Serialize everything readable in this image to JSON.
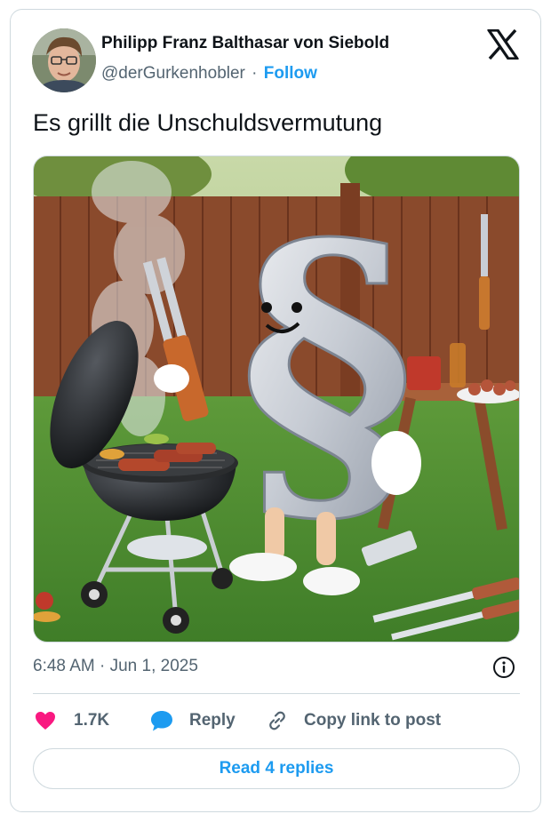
{
  "author": {
    "name": "Philipp Franz Balthasar von Siebold",
    "handle": "@derGurkenhobler",
    "separator": "·",
    "follow_label": "Follow"
  },
  "tweet": {
    "text": "Es grillt die Unschuldsvermutung",
    "timestamp": "6:48 AM · Jun 1, 2025",
    "media_alt": "Cartoon of a § paragraph sign character grilling sausages on a kettle barbecue in a garden"
  },
  "actions": {
    "like_count": "1.7K",
    "reply_label": "Reply",
    "copy_label": "Copy link to post"
  },
  "read_replies_label": "Read 4 replies",
  "media_overlay_glyph": "§",
  "icons": {
    "brand": "x-logo-icon",
    "like": "heart-icon",
    "reply": "speech-bubble-icon",
    "copy": "link-icon",
    "info": "info-icon"
  },
  "colors": {
    "link": "#1d9bf0",
    "like": "#f91880",
    "muted": "#536471",
    "text": "#0f1419",
    "border": "#cfd9de"
  }
}
